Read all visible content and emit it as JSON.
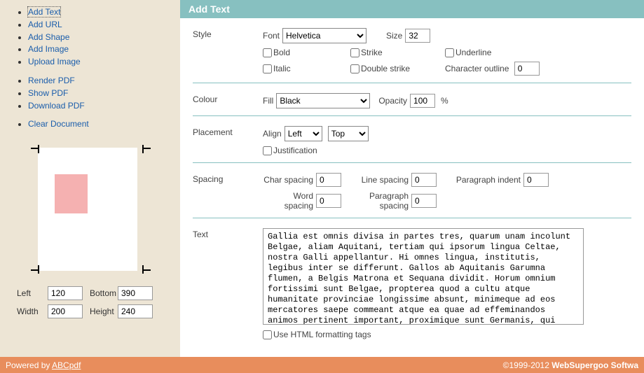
{
  "sidebar": {
    "groups": [
      [
        "Add Text",
        "Add URL",
        "Add Shape",
        "Add Image",
        "Upload Image"
      ],
      [
        "Render PDF",
        "Show PDF",
        "Download PDF"
      ],
      [
        "Clear Document"
      ]
    ]
  },
  "coords": {
    "left_label": "Left",
    "left": "120",
    "bottom_label": "Bottom",
    "bottom": "390",
    "width_label": "Width",
    "width": "200",
    "height_label": "Height",
    "height": "240"
  },
  "panel": {
    "title": "Add Text"
  },
  "style": {
    "label": "Style",
    "font_label": "Font",
    "font": "Helvetica",
    "size_label": "Size",
    "size": "32",
    "bold": "Bold",
    "italic": "Italic",
    "strike": "Strike",
    "double_strike": "Double strike",
    "underline": "Underline",
    "outline_label": "Character outline",
    "outline": "0"
  },
  "colour": {
    "label": "Colour",
    "fill_label": "Fill",
    "fill": "Black",
    "opacity_label": "Opacity",
    "opacity": "100",
    "pct": "%"
  },
  "placement": {
    "label": "Placement",
    "align_label": "Align",
    "h": "Left",
    "v": "Top",
    "justification": "Justification"
  },
  "spacing": {
    "label": "Spacing",
    "char_label": "Char spacing",
    "char": "0",
    "word_label": "Word spacing",
    "word": "0",
    "line_label": "Line spacing",
    "line": "0",
    "para_label": "Paragraph spacing",
    "para": "0",
    "indent_label": "Paragraph indent",
    "indent": "0"
  },
  "text": {
    "label": "Text",
    "value": "Gallia est omnis divisa in partes tres, quarum unam incolunt Belgae, aliam Aquitani, tertiam qui ipsorum lingua Celtae, nostra Galli appellantur. Hi omnes lingua, institutis, legibus inter se differunt. Gallos ab Aquitanis Garumna flumen, a Belgis Matrona et Sequana dividit. Horum omnium fortissimi sunt Belgae, propterea quod a cultu atque humanitate provinciae longissime absunt, minimeque ad eos mercatores saepe commeant atque ea quae ad effeminandos animos pertinent important, proximique sunt Germanis, qui trans Rhenum incolunt, quibuscum continenter bellum gerunt.",
    "html_cb": "Use HTML formatting tags"
  },
  "footer": {
    "powered_prefix": "Powered by ",
    "powered_link": "ABCpdf",
    "copyright": "©1999-2012 ",
    "company": "WebSupergoo Softwa"
  }
}
